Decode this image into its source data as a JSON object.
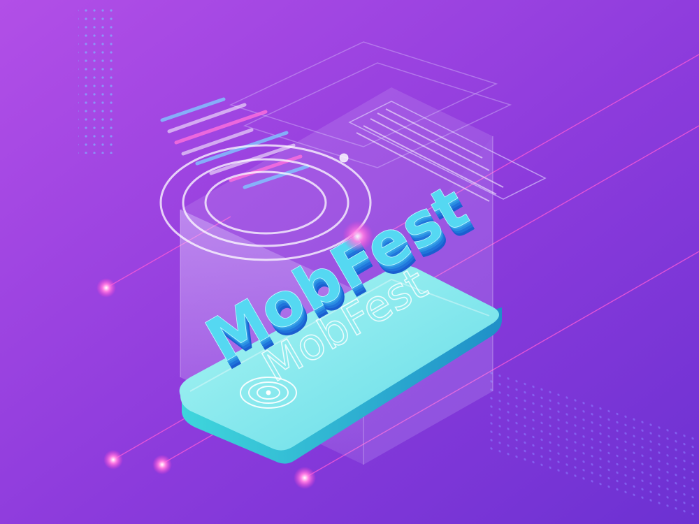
{
  "brand": {
    "name_3d": "MobFest",
    "name_outline": "MobFest"
  },
  "colors": {
    "background_top_left": "#b14ee6",
    "background_bottom_right": "#6a2fd0",
    "phone_screen": "#7fe9ee",
    "phone_edge": "#36c9d8",
    "text_front": "#4fd6f0",
    "text_side": "#1b6fd6",
    "glow": "#ff5bd8",
    "panel": "#d8d0ff"
  },
  "icons": {
    "hologram_rings": "concentric-rings-icon",
    "screen_target": "target-rings-icon"
  }
}
